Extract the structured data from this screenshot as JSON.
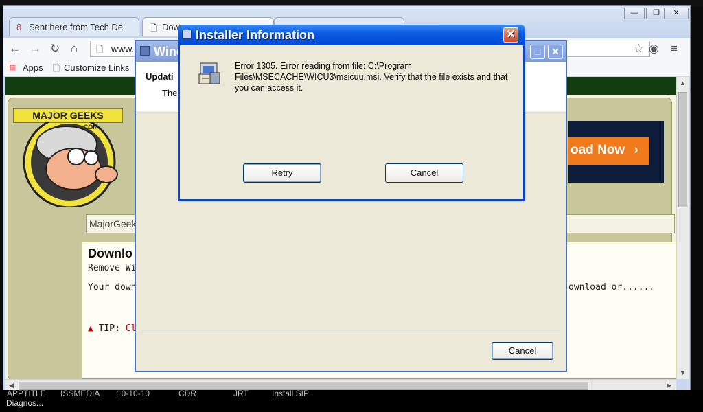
{
  "browser": {
    "tabs": [
      {
        "label": "Sent here from Tech De"
      },
      {
        "label": "Dow"
      }
    ],
    "address": "www.",
    "bookmarks": {
      "apps": "Apps",
      "customize": "Customize Links"
    }
  },
  "page": {
    "search_text": "MajorGeek",
    "download_button": "oad Now",
    "panel_title": "Downlo",
    "panel_sub": "Remove Wi",
    "panel_line": "Your downl",
    "panel_line_right": "ownload or......",
    "tip_label": "TIP:",
    "tip_link": "Cli"
  },
  "logo": {
    "text": "MAJOR GEEKS",
    "sub": ".COM"
  },
  "installer_window": {
    "title": "Wind",
    "heading": "Updati",
    "subtext": "The",
    "cancel_label": "Cancel"
  },
  "dialog": {
    "title": "Installer Information",
    "message": "Error 1305. Error reading from file: C:\\Program Files\\MSECACHE\\WICU3\\msicuu.msi.  Verify that the file exists and that you can access it.",
    "retry_label": "Retry",
    "cancel_label": "Cancel"
  },
  "desktop": {
    "row_cols": [
      "APPTITLE",
      "ISSMEDIA",
      "10-10-10",
      "CDR",
      "JRT",
      "Install SIP"
    ],
    "row_label": "Diagnos..."
  },
  "colors": {
    "xp_blue": "#0048d8",
    "close_red": "#d24626",
    "download_orange": "#f07a1c",
    "mg_green": "#113d11"
  }
}
